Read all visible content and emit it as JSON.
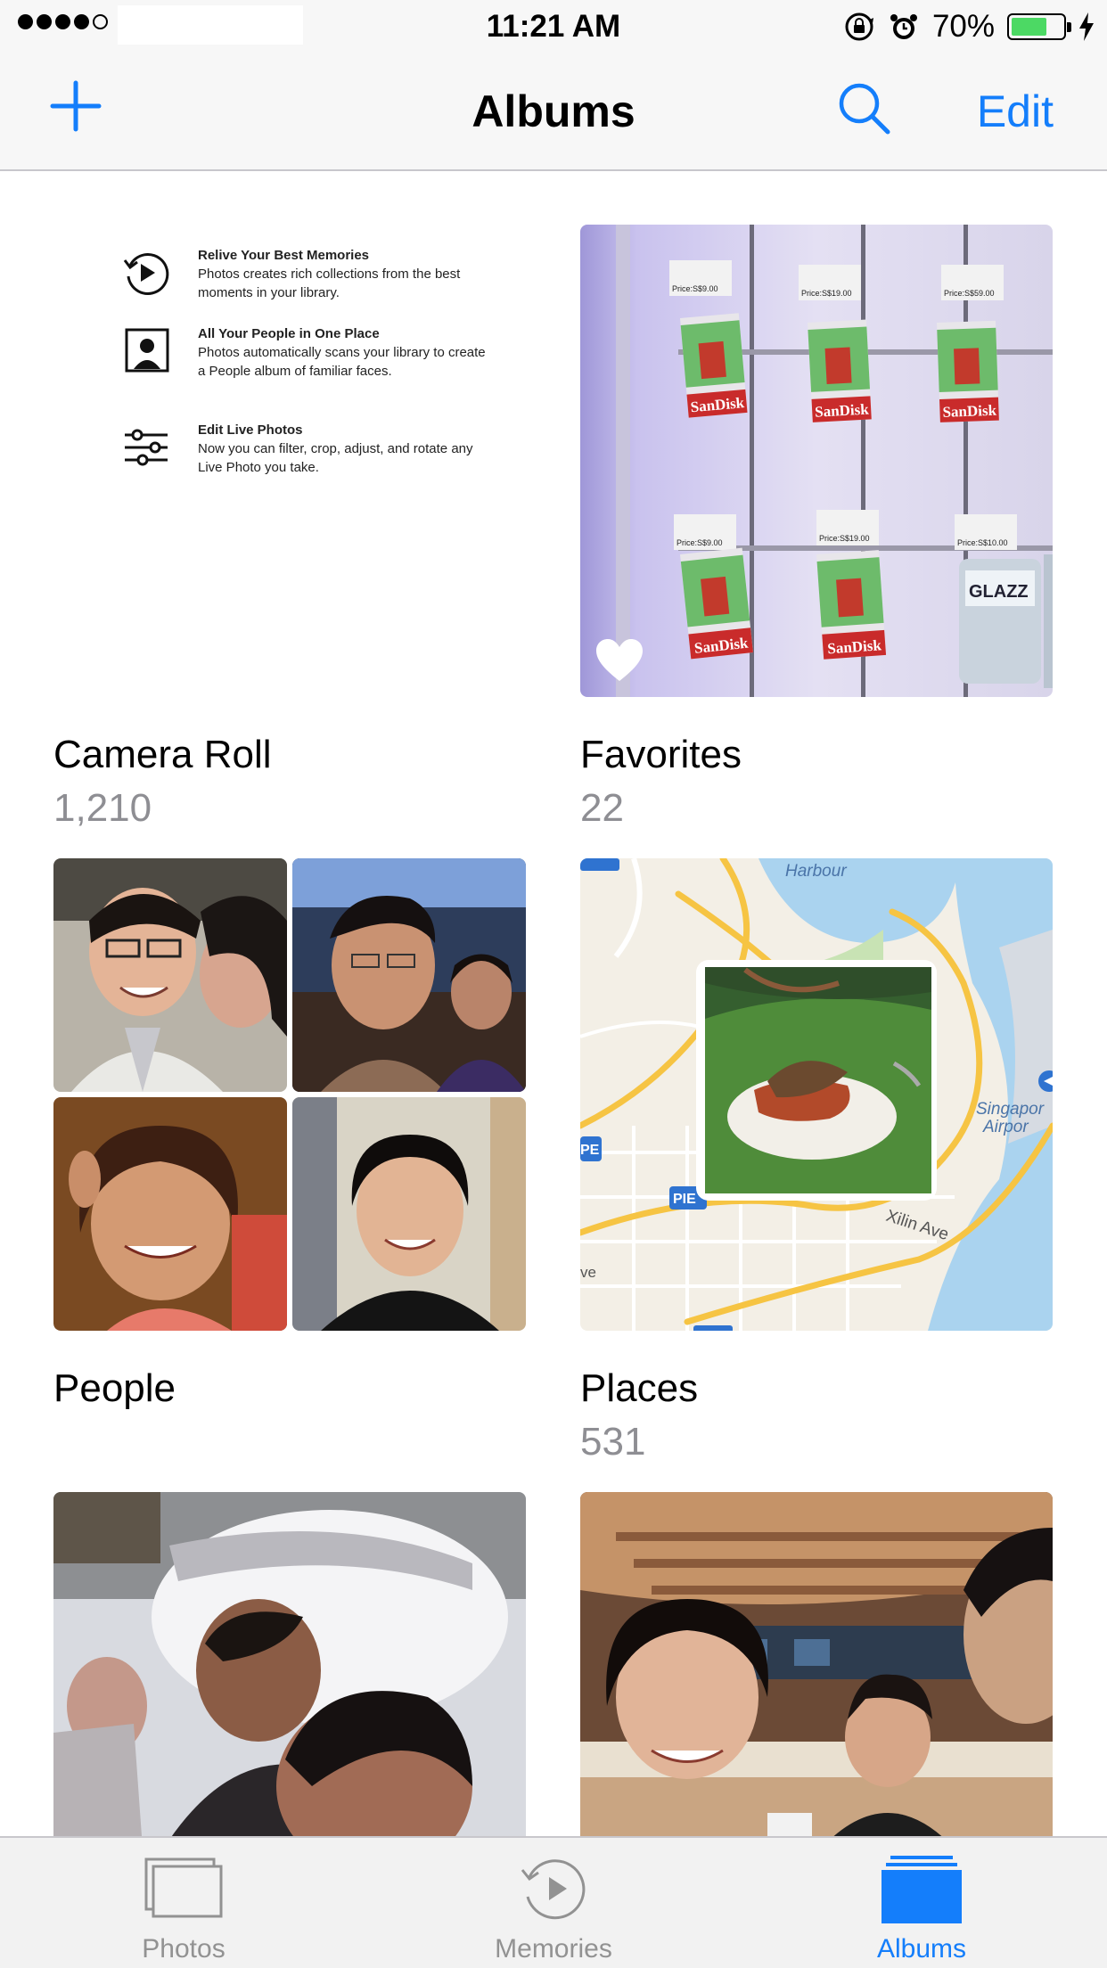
{
  "status_bar": {
    "time": "11:21 AM",
    "battery_percent": "70%",
    "battery_level": 0.7,
    "signal_bars_filled": 4,
    "signal_bars_total": 5,
    "icons": [
      "rotation-lock-icon",
      "alarm-icon",
      "battery-icon",
      "charging-bolt-icon"
    ]
  },
  "nav": {
    "title": "Albums",
    "edit_label": "Edit",
    "add_icon": "plus-icon",
    "search_icon": "search-icon"
  },
  "colors": {
    "accent": "#147efb",
    "battery_green": "#4cd964",
    "secondary_text": "#8e8e93",
    "tab_inactive": "#929292"
  },
  "albums": [
    {
      "name": "Camera Roll",
      "count": "1,210",
      "thumbnail": {
        "items": [
          {
            "title": "Relive Your Best Memories",
            "body": "Photos creates rich collections from the best moments in your library.",
            "icon": "memories-icon"
          },
          {
            "title": "All Your People in One Place",
            "body": "Photos automatically scans your library to create a People album of familiar faces.",
            "icon": "person-icon"
          },
          {
            "title": "Edit Live Photos",
            "body": "Now you can filter, crop, adjust, and rotate any Live Photo you take.",
            "icon": "sliders-icon"
          }
        ]
      }
    },
    {
      "name": "Favorites",
      "count": "22",
      "thumbnail": {
        "type": "photo-store-shelf",
        "badge_icon": "heart-icon",
        "shelf_labels": [
          "SanDisk",
          "SanDisk",
          "SanDisk",
          "SanDisk",
          "SanDisk"
        ],
        "price_tags": [
          "Price:S$9.00",
          "Price:S$19.00",
          "Price:S$59.00",
          "Price:S$9.00",
          "Price:S$19.00",
          "Price:S$10.00"
        ],
        "product_label": "GLAZZ"
      }
    },
    {
      "name": "People",
      "count": "",
      "thumbnail": {
        "type": "face-grid",
        "tiles": 4
      }
    },
    {
      "name": "Places",
      "count": "531",
      "thumbnail": {
        "type": "map",
        "labels": [
          "Harbour",
          "Singapor",
          "Airpor",
          "Xilin Ave",
          "ve"
        ],
        "road_shields": [
          "PIE",
          "PIE",
          "PE"
        ]
      }
    },
    {
      "name": "",
      "count": "",
      "thumbnail": {
        "type": "photo-selfie"
      }
    },
    {
      "name": "",
      "count": "",
      "thumbnail": {
        "type": "photo-cafe"
      }
    }
  ],
  "tabs": [
    {
      "label": "Photos",
      "icon": "photos-tab-icon",
      "active": false
    },
    {
      "label": "Memories",
      "icon": "memories-tab-icon",
      "active": false
    },
    {
      "label": "Albums",
      "icon": "albums-tab-icon",
      "active": true
    }
  ]
}
